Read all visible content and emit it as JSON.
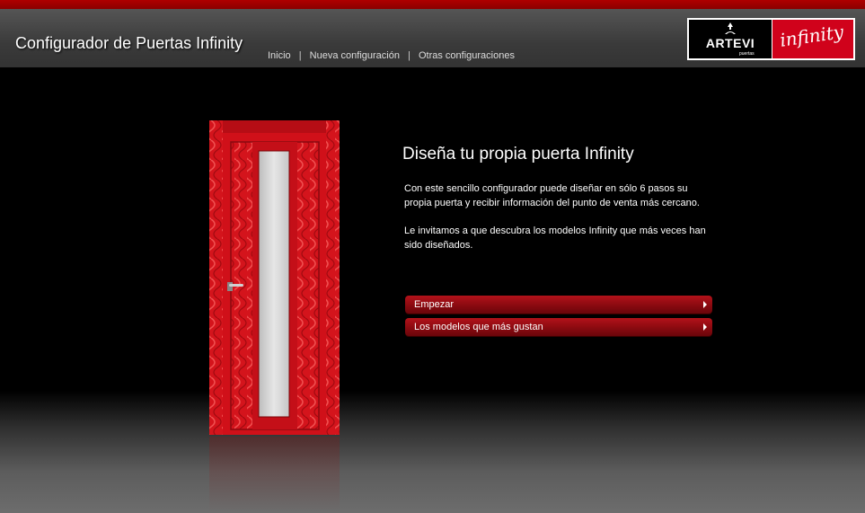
{
  "header": {
    "title": "Configurador de Puertas Infinity",
    "nav": [
      {
        "label": "Inicio"
      },
      {
        "label": "Nueva configuración"
      },
      {
        "label": "Otras configuraciones"
      }
    ],
    "nav_separator": "|",
    "logo": {
      "brand": "ARTEVI",
      "brand_sub": "puertas",
      "product": "infinity"
    }
  },
  "main": {
    "heading": "Diseña tu propia puerta Infinity",
    "paragraphs": [
      "Con este sencillo configurador puede diseñar en sólo 6 pasos su propia puerta y recibir información del punto de venta más cercano.",
      "Le invitamos a que descubra los modelos Infinity que más veces han sido diseñados."
    ],
    "buttons": [
      {
        "label": "Empezar",
        "icon": "arrow-right-icon"
      },
      {
        "label": "Los modelos que más gustan",
        "icon": "arrow-right-icon"
      }
    ]
  },
  "colors": {
    "accent": "#b00000",
    "door_red": "#d8141c",
    "header_bg": "#444444"
  }
}
